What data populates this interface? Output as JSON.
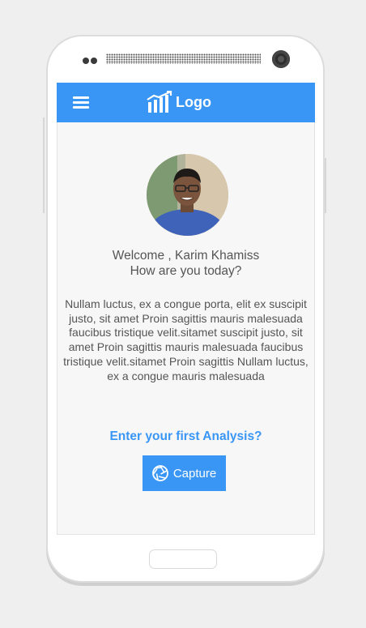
{
  "header": {
    "logo_text": "Logo",
    "menu_icon": "hamburger-menu-icon",
    "logo_icon": "bar-chart-logo-icon",
    "color": "#3996f5"
  },
  "welcome": {
    "line1": "Welcome , Karim Khamiss",
    "line2": "How are you today?"
  },
  "description": "Nullam luctus, ex a congue porta, elit ex suscipit justo, sit amet Proin sagittis mauris malesuada faucibus tristique velit.sitamet suscipit justo, sit amet Proin sagittis mauris malesuada faucibus tristique velit.sitamet Proin sagittis Nullam luctus, ex a congue mauris malesuada",
  "cta": {
    "prompt": "Enter your first Analysis?",
    "button_label": "Capture",
    "button_icon": "aperture-icon"
  }
}
